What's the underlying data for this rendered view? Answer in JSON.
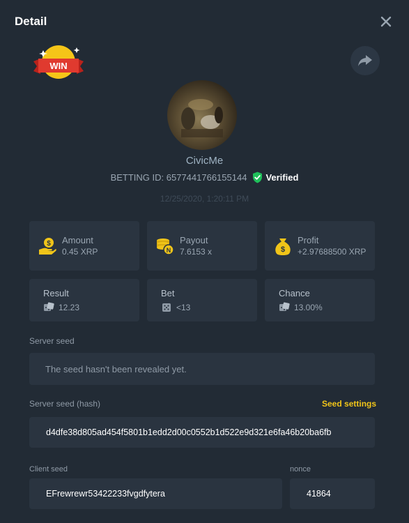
{
  "header": {
    "title": "Detail"
  },
  "badge": {
    "text": "WIN"
  },
  "user": {
    "name": "CivicMe"
  },
  "bet": {
    "betting_id_label": "BETTING ID: 6577441766155144",
    "verified_label": "Verified",
    "timestamp": "12/25/2020, 1:20:11 PM"
  },
  "stats": [
    {
      "label": "Amount",
      "value": "0.45 XRP",
      "icon": "coin-hand-icon"
    },
    {
      "label": "Payout",
      "value": "7.6153 x",
      "icon": "coin-stack-icon"
    },
    {
      "label": "Profit",
      "value": "+2.97688500 XRP",
      "icon": "money-bag-icon"
    }
  ],
  "details": [
    {
      "label": "Result",
      "value": "12.23",
      "icon": "dice-icon"
    },
    {
      "label": "Bet",
      "value": "<13",
      "icon": "dice-icon"
    },
    {
      "label": "Chance",
      "value": "13.00%",
      "icon": "dice-icon"
    }
  ],
  "server_seed": {
    "label": "Server seed",
    "value": "The seed hasn't been revealed yet."
  },
  "server_seed_hash": {
    "label": "Server seed (hash)",
    "link": "Seed settings",
    "value": "d4dfe38d805ad454f5801b1edd2d00c0552b1d522e9d321e6fa46b20ba6fb"
  },
  "client_seed": {
    "label": "Client seed",
    "value": "EFrewrewr53422233fvgdfytera"
  },
  "nonce": {
    "label": "nonce",
    "value": "41864"
  },
  "colors": {
    "background": "#222b35",
    "card": "#2a3440",
    "accent_yellow": "#f0c419",
    "verified_green": "#1fc05a"
  }
}
